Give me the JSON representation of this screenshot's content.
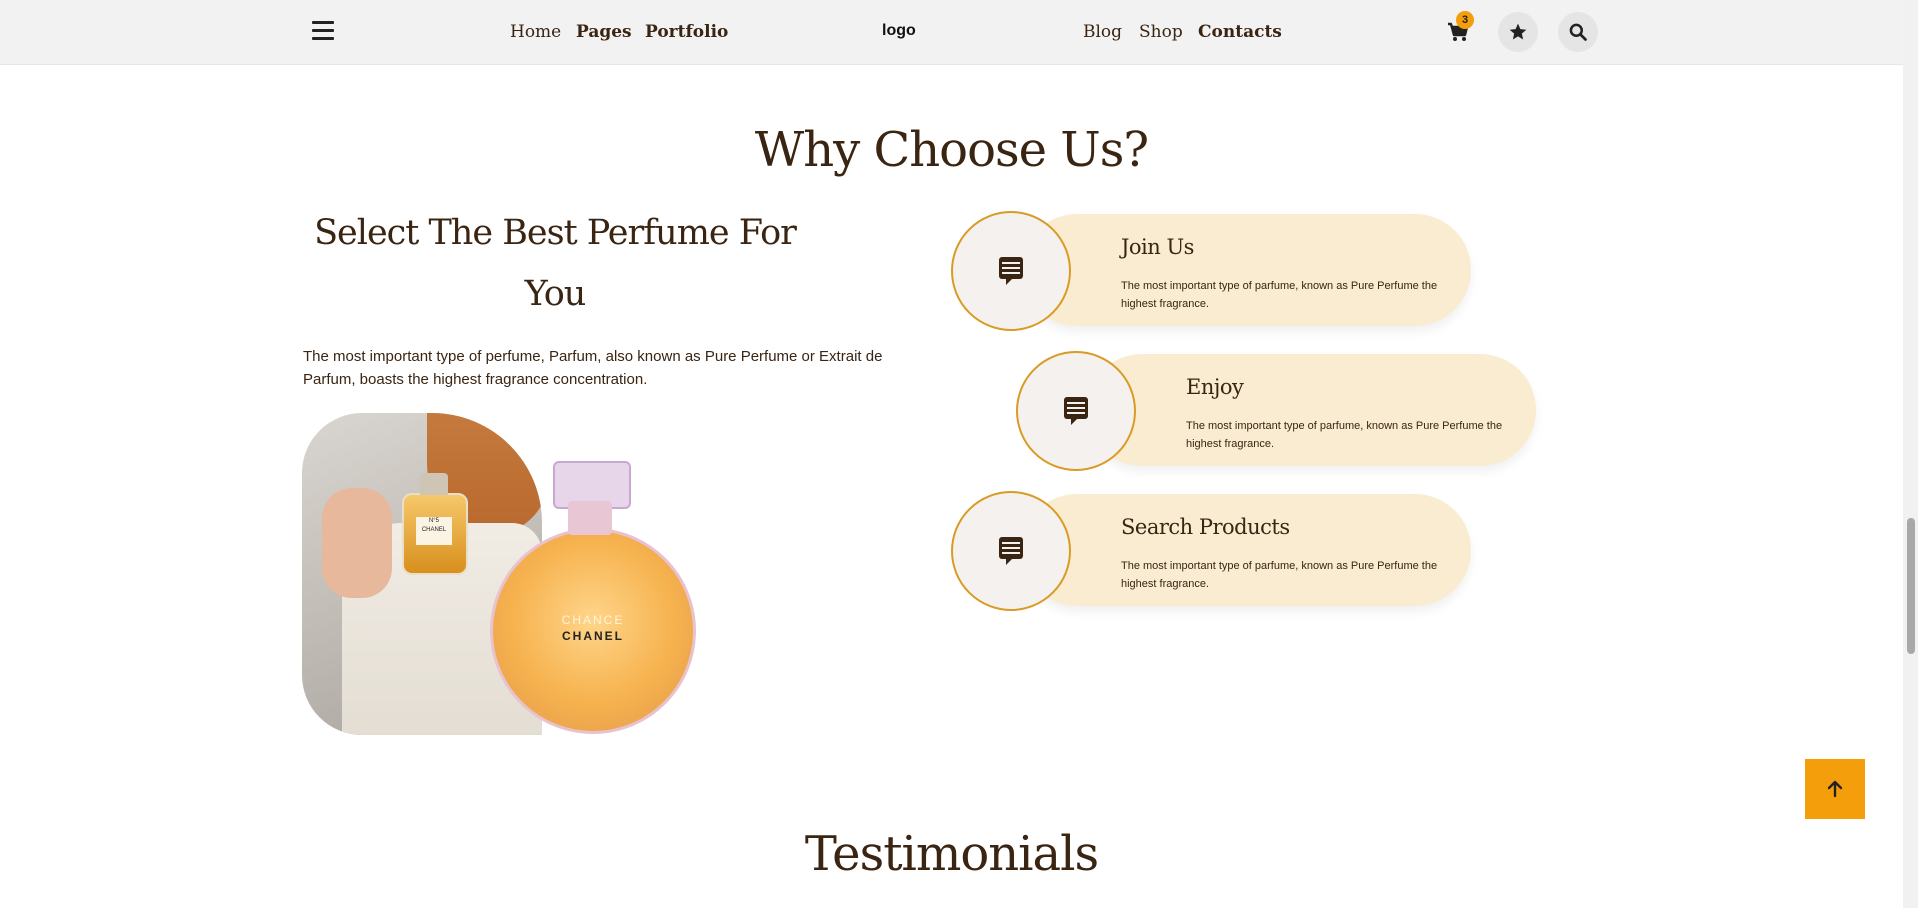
{
  "header": {
    "nav_left": [
      "Home",
      "Pages",
      "Portfolio"
    ],
    "logo": "logo",
    "nav_right": [
      "Blog",
      "Shop",
      "Contacts"
    ],
    "cart_count": "3",
    "icons": [
      "menu-icon",
      "cart-icon",
      "star-icon",
      "search-icon"
    ]
  },
  "why": {
    "title": "Why Choose Us?",
    "subtitle": "Select The Best Perfume For You",
    "intro": "The most important type of perfume, Parfum, also known as Pure Perfume or Extrait de Parfum, boasts the highest fragrance concentration.",
    "image": {
      "small_bottle_label": "N°5 CHANEL",
      "round_bottle_line1": "CHANCE",
      "round_bottle_line2": "CHANEL"
    }
  },
  "features": [
    {
      "title": "Join Us",
      "desc": "The most important type of parfume, known as Pure Perfume the highest fragrance.",
      "icon": "chat-icon"
    },
    {
      "title": "Enjoy",
      "desc": "The most important type of parfume, known as Pure Perfume the highest fragrance.",
      "icon": "chat-icon"
    },
    {
      "title": "Search Products",
      "desc": "The most important type of parfume, known as Pure Perfume the highest fragrance.",
      "icon": "chat-icon"
    }
  ],
  "testimonials": {
    "title": "Testimonials"
  },
  "colors": {
    "brand_brown": "#3a2412",
    "accent_orange": "#f59e0b",
    "card_cream": "#f9ecd1"
  }
}
